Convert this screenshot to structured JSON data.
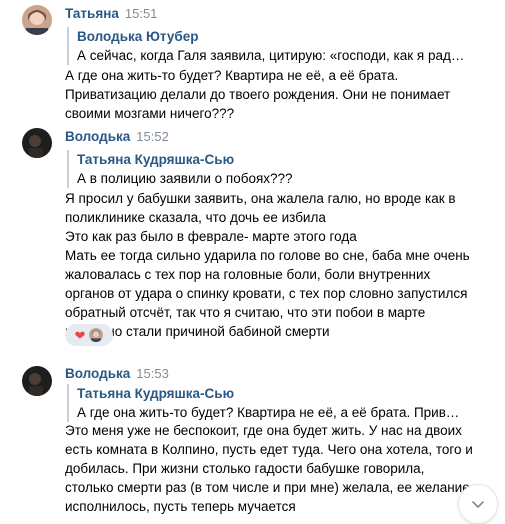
{
  "messages": [
    {
      "author": "Татьяна",
      "time": "15:51",
      "quote": {
        "author": "Володька Ютубер",
        "text": "А сейчас, когда Галя заявила, цитирую: «господи, как я рада,..."
      },
      "lines": [
        "А где она жить-то будет? Квартира не её, а её брата.",
        "Приватизацию делали до твоего рождения. Они не понимает",
        "своими мозгами ничего???"
      ]
    },
    {
      "author": "Володька",
      "time": "15:52",
      "quote": {
        "author": "Татьяна Кудряшка-Сью",
        "text": "А в полицию заявили о побоях???"
      },
      "lines": [
        "Я просил у бабушки заявить, она жалела галю, но вроде как в",
        "поликлинике сказала, что дочь ее избила",
        "Это как раз было в феврале- марте этого года",
        "Мать ее тогда сильно ударила по голове во сне, баба мне очень",
        "жаловалась с тех пор на головные боли, боли внутренних",
        "органов от удара о спинку кровати, с тех пор словно запустился",
        "обратный отсчёт, так что я считаю, что эти побои в марте",
        "косвенно стали причиной бабиной смерти"
      ],
      "reactions": [
        "heart-icon",
        "user-avatar"
      ]
    },
    {
      "author": "Володька",
      "time": "15:53",
      "quote": {
        "author": "Татьяна Кудряшка-Сью",
        "text": "А где она жить-то будет? Квартира не её, а её брата. Приват..."
      },
      "lines": [
        "Это меня уже не беспокоит, где она будет жить. У нас на двоих",
        "есть комната в Колпино, пусть едет туда. Чего она хотела, того и",
        "добилась. При жизни столько гадости бабушке говорила,",
        "столько смерти раз (в том числе и при мне) желала, ее желание",
        "исполнилось, пусть теперь мучается"
      ]
    }
  ],
  "colors": {
    "author": "#2a5885",
    "time": "#818c99",
    "quote_border": "#c5d0db",
    "reaction_bg": "#e5ebf1"
  }
}
